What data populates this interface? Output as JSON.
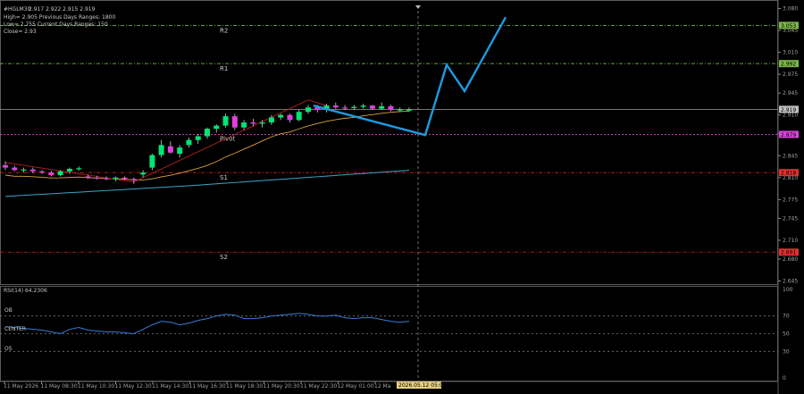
{
  "symbol": "#HGLM30",
  "ohlc": "2.917 2.922 2.915 2.919",
  "info_lines": [
    "High= 2.905   Previous Days Ranges: 1800",
    "Low= 2.755   Current Days Ranges: 150",
    "Close= 2.93"
  ],
  "price_axis_ticks": [
    "3.080",
    "3.045",
    "3.010",
    "2.975",
    "2.945",
    "2.910",
    "2.880",
    "2.845",
    "2.810",
    "2.775",
    "2.745",
    "2.710",
    "2.680",
    "2.645"
  ],
  "levels": [
    {
      "label": "R2",
      "value": "3.053",
      "color": "#7ab648",
      "tag_color": "#7ab648"
    },
    {
      "label": "R1",
      "value": "2.992",
      "color": "#7ab648",
      "tag_color": "#7ab648"
    },
    {
      "label": "",
      "value": "2.919",
      "color": "#9a9a9a",
      "tag_color": "#c0c0c0"
    },
    {
      "label": "Pivot",
      "value": "2.879",
      "color": "#d946d9",
      "tag_color": "#d946d9"
    },
    {
      "label": "S1",
      "value": "2.818",
      "color": "#d42020",
      "tag_color": "#e03030"
    },
    {
      "label": "S2",
      "value": "2.691",
      "color": "#d42020",
      "tag_color": "#e03030"
    }
  ],
  "rsi": {
    "label": "RSI(14) 64.2306",
    "ticks": [
      "100",
      "70",
      "50",
      "30",
      "0"
    ],
    "zones": [
      "OB",
      "CENTER",
      "OS"
    ]
  },
  "time_axis": [
    "11 May 2026",
    "11 May 08:30",
    "11 May 10:30",
    "11 May 12:30",
    "11 May 14:30",
    "11 May 16:30",
    "11 May 18:30",
    "11 May 20:30",
    "11 May 22:30",
    "12 May 01:00",
    "12 Ma"
  ],
  "cursor_time": "2026.05.12 05:00",
  "colors": {
    "bull": "#00e676",
    "bear": "#e040e0",
    "forecast": "#1e9be0",
    "ma_fast": "#d9a13a",
    "ma_slow": "#3aa6c8",
    "rsi": "#3a7bd5"
  },
  "chart_data": {
    "type": "candlestick",
    "title": "#HGLM30",
    "candles": [
      [
        2.83,
        2.836,
        2.822,
        2.826
      ],
      [
        2.826,
        2.829,
        2.82,
        2.822
      ],
      [
        2.822,
        2.826,
        2.818,
        2.823
      ],
      [
        2.823,
        2.826,
        2.817,
        2.82
      ],
      [
        2.82,
        2.822,
        2.816,
        2.818
      ],
      [
        2.818,
        2.821,
        2.812,
        2.814
      ],
      [
        2.814,
        2.822,
        2.812,
        2.82
      ],
      [
        2.82,
        2.826,
        2.816,
        2.824
      ],
      [
        2.824,
        2.828,
        2.821,
        2.825
      ],
      [
        2.812,
        2.815,
        2.808,
        2.81
      ],
      [
        2.81,
        2.813,
        2.807,
        2.809
      ],
      [
        2.809,
        2.812,
        2.806,
        2.808
      ],
      [
        2.808,
        2.812,
        2.804,
        2.81
      ],
      [
        2.81,
        2.812,
        2.806,
        2.808
      ],
      [
        2.808,
        2.81,
        2.8,
        2.806
      ],
      [
        2.815,
        2.822,
        2.81,
        2.818
      ],
      [
        2.826,
        2.848,
        2.822,
        2.846
      ],
      [
        2.846,
        2.87,
        2.842,
        2.862
      ],
      [
        2.86,
        2.868,
        2.848,
        2.85
      ],
      [
        2.848,
        2.862,
        2.842,
        2.858
      ],
      [
        2.862,
        2.874,
        2.858,
        2.87
      ],
      [
        2.87,
        2.88,
        2.864,
        2.876
      ],
      [
        2.876,
        2.89,
        2.872,
        2.888
      ],
      [
        2.888,
        2.895,
        2.882,
        2.893
      ],
      [
        2.893,
        2.912,
        2.89,
        2.908
      ],
      [
        2.908,
        2.912,
        2.886,
        2.89
      ],
      [
        2.89,
        2.902,
        2.886,
        2.898
      ],
      [
        2.898,
        2.904,
        2.892,
        2.896
      ],
      [
        2.896,
        2.902,
        2.89,
        2.898
      ],
      [
        2.898,
        2.91,
        2.894,
        2.906
      ],
      [
        2.906,
        2.912,
        2.902,
        2.91
      ],
      [
        2.91,
        2.912,
        2.898,
        2.902
      ],
      [
        2.902,
        2.918,
        2.9,
        2.915
      ],
      [
        2.915,
        2.926,
        2.912,
        2.922
      ],
      [
        2.922,
        2.926,
        2.914,
        2.918
      ],
      [
        2.918,
        2.928,
        2.914,
        2.925
      ],
      [
        2.925,
        2.93,
        2.92,
        2.922
      ],
      [
        2.922,
        2.926,
        2.918,
        2.921
      ],
      [
        2.921,
        2.926,
        2.918,
        2.923
      ],
      [
        2.923,
        2.928,
        2.92,
        2.925
      ],
      [
        2.925,
        2.926,
        2.918,
        2.92
      ],
      [
        2.92,
        2.93,
        2.918,
        2.924
      ],
      [
        2.924,
        2.926,
        2.916,
        2.918
      ],
      [
        2.918,
        2.922,
        2.915,
        2.919
      ],
      [
        2.917,
        2.922,
        2.915,
        2.919
      ]
    ],
    "forecast_path": [
      2.925,
      2.878,
      2.99,
      2.948,
      3.066
    ],
    "ylim": [
      2.64,
      3.085
    ],
    "rsi_values": [
      58,
      57,
      56,
      55,
      54,
      52,
      50,
      55,
      57,
      54,
      53,
      52,
      52,
      51,
      50,
      55,
      60,
      64,
      63,
      60,
      62,
      65,
      67,
      70,
      72,
      71,
      67,
      67,
      68,
      70,
      71,
      72,
      73,
      72,
      70,
      70,
      71,
      68,
      67,
      68,
      68,
      66,
      64,
      63,
      64
    ],
    "rsi_ylim": [
      0,
      100
    ]
  }
}
